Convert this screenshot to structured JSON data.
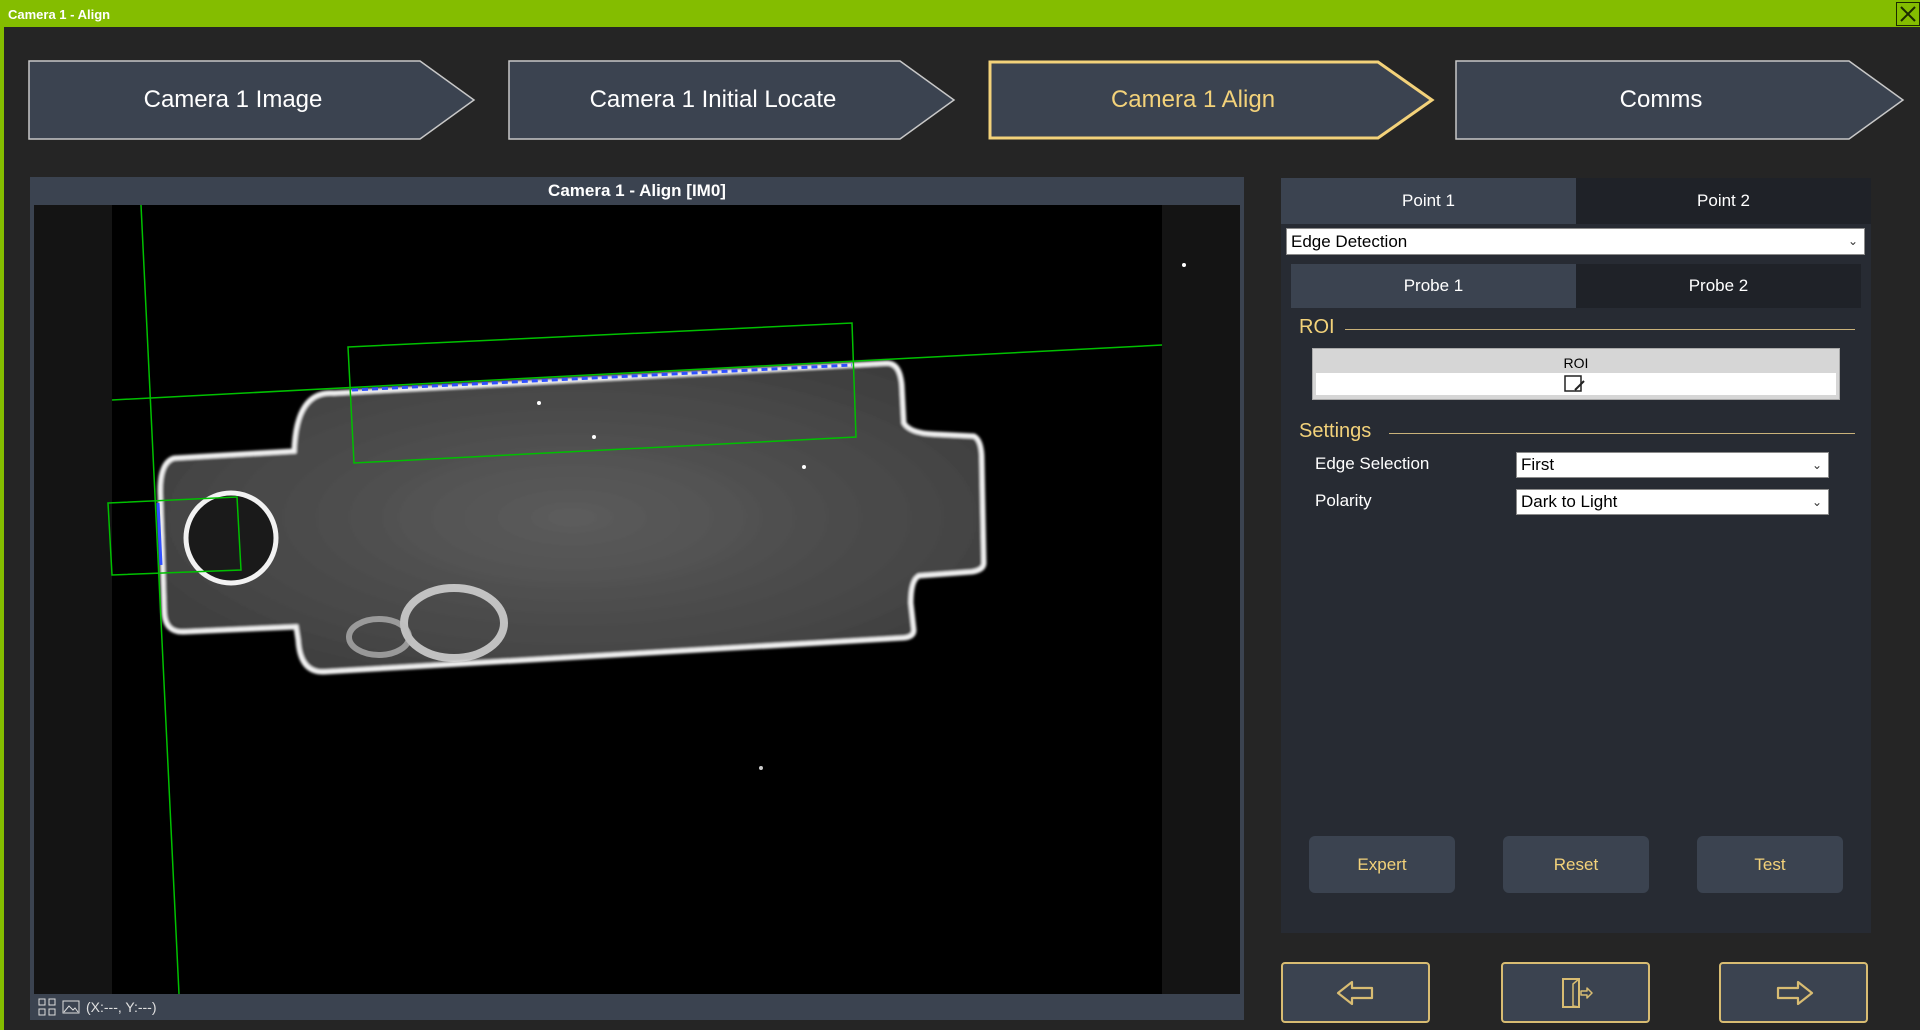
{
  "window": {
    "title": "Camera 1 - Align"
  },
  "steps": [
    {
      "label": "Camera 1 Image",
      "active": false
    },
    {
      "label": "Camera 1 Initial Locate",
      "active": false
    },
    {
      "label": "Camera 1 Align",
      "active": true
    },
    {
      "label": "Comms",
      "active": false
    }
  ],
  "image_panel": {
    "title": "Camera 1 - Align  [IM0]",
    "coords": "(X:---, Y:---)"
  },
  "right_panel": {
    "point_tabs": [
      "Point 1",
      "Point 2"
    ],
    "selected_point": "Point 1",
    "tool_select": {
      "value": "Edge Detection"
    },
    "probe_tabs": [
      "Probe 1",
      "Probe 2"
    ],
    "selected_probe": "Probe 1",
    "roi_section": {
      "label": "ROI",
      "field_caption": "ROI"
    },
    "settings_section": {
      "label": "Settings",
      "edge_selection": {
        "label": "Edge Selection",
        "value": "First"
      },
      "polarity": {
        "label": "Polarity",
        "value": "Dark to Light"
      }
    },
    "buttons": {
      "expert": "Expert",
      "reset": "Reset",
      "test": "Test"
    }
  },
  "navigation": {
    "back_icon": "arrow-left-icon",
    "exit_icon": "exit-door-icon",
    "next_icon": "arrow-right-icon"
  },
  "colors": {
    "accent_green": "#84bd00",
    "gold": "#f3d27a",
    "panel": "#3b4350",
    "background": "#252525",
    "overlay_green": "#00c000",
    "edge_blue": "#3050ff"
  }
}
